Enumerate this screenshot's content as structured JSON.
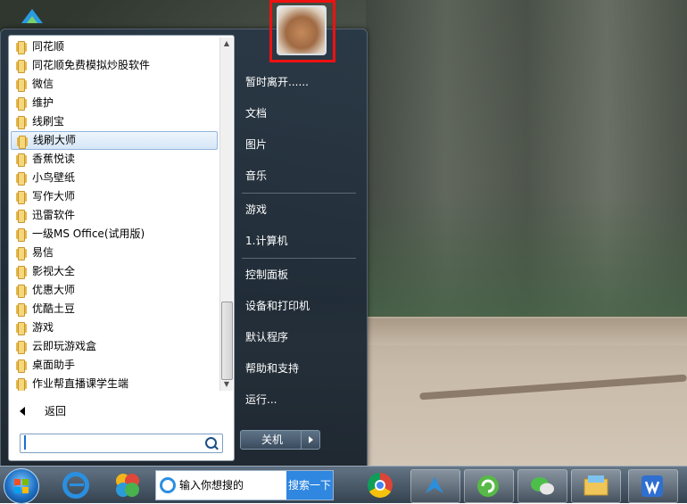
{
  "start_menu": {
    "programs": [
      {
        "label": "同花顺"
      },
      {
        "label": "同花顺免费模拟炒股软件"
      },
      {
        "label": "微信"
      },
      {
        "label": "维护"
      },
      {
        "label": "线刷宝"
      },
      {
        "label": "线刷大师",
        "selected": true
      },
      {
        "label": "香蕉悦读"
      },
      {
        "label": "小鸟壁纸"
      },
      {
        "label": "写作大师"
      },
      {
        "label": "迅雷软件"
      },
      {
        "label": "一级MS Office(试用版)"
      },
      {
        "label": "易信"
      },
      {
        "label": "影视大全"
      },
      {
        "label": "优惠大师"
      },
      {
        "label": "优酷土豆"
      },
      {
        "label": "游戏"
      },
      {
        "label": "云即玩游戏盒"
      },
      {
        "label": "桌面助手"
      },
      {
        "label": "作业帮直播课学生端"
      }
    ],
    "back_label": "返回",
    "search_value": "",
    "right_items": [
      {
        "label": "暂时离开......"
      },
      {
        "label": "文档"
      },
      {
        "label": "图片"
      },
      {
        "label": "音乐"
      },
      {
        "label": "游戏"
      },
      {
        "label": "1.计算机"
      },
      {
        "label": "控制面板"
      },
      {
        "label": "设备和打印机"
      },
      {
        "label": "默认程序"
      },
      {
        "label": "帮助和支持"
      },
      {
        "label": "运行..."
      }
    ],
    "shutdown_label": "关机"
  },
  "taskbar": {
    "search_placeholder": "输入你想搜的",
    "search_button": "搜索一下"
  },
  "icons": {
    "folder": "folder-icon",
    "ie": "internet-explorer-icon",
    "chrome": "chrome-icon",
    "wechat": "wechat-icon",
    "wps": "wps-icon"
  },
  "colors": {
    "highlight_frame": "#ee1111",
    "selected_item": "#d5e6f7",
    "taskbar_search_button": "#2f87e0"
  }
}
